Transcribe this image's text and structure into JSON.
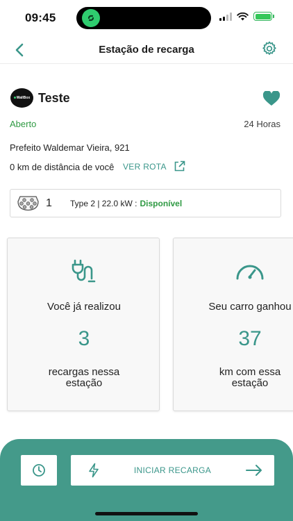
{
  "status_bar": {
    "time": "09:45"
  },
  "header": {
    "title": "Estação de recarga"
  },
  "station": {
    "logo_text": "WallBox",
    "name": "Teste",
    "status": "Aberto",
    "hours": "24 Horas",
    "address": "Prefeito Waldemar Vieira, 921",
    "distance": "0 km de distância de você",
    "route_link": "VER ROTA"
  },
  "connector": {
    "count": "1",
    "spec": "Type 2 | 22.0 kW :",
    "status": "Disponível"
  },
  "stats": [
    {
      "heading": "Você já realizou",
      "value": "3",
      "caption": "recargas nessa\nestação"
    },
    {
      "heading": "Seu carro ganhou",
      "value": "37",
      "caption": "km com essa\nestação"
    }
  ],
  "actions": {
    "start_label": "INICIAR RECARGA"
  },
  "colors": {
    "accent": "#3a968a",
    "bar": "#449a8a",
    "open": "#2f9a43"
  },
  "icons": {
    "back": "chevron-left-icon",
    "settings": "gear-icon",
    "favorite": "heart-icon",
    "external": "external-link-icon",
    "plug": "type2-plug-icon",
    "charger": "charger-cable-icon",
    "speed": "speedometer-icon",
    "history": "clock-icon",
    "bolt": "bolt-icon",
    "arrow": "arrow-right-icon"
  }
}
